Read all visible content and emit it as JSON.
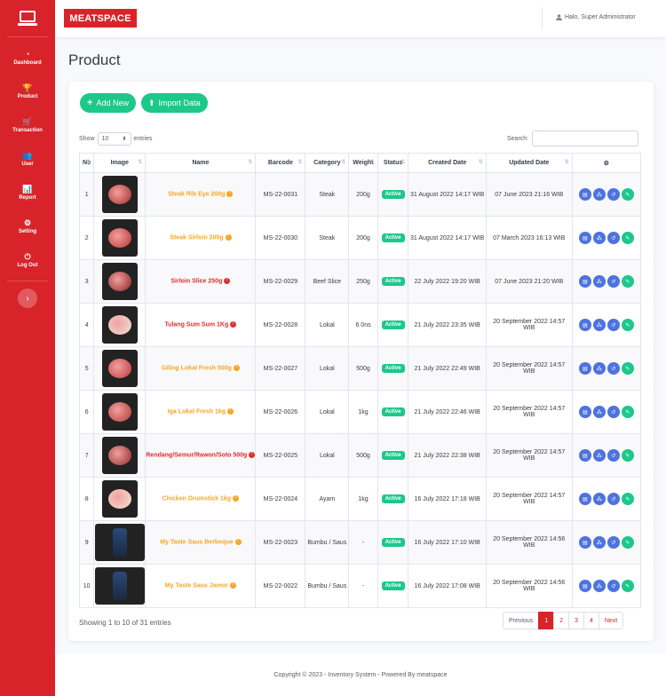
{
  "sidebar": {
    "items": [
      {
        "label": "Dashboard",
        "icon": "gauge-icon",
        "glyph": "◔"
      },
      {
        "label": "Product",
        "icon": "trophy-icon",
        "glyph": "🏆"
      },
      {
        "label": "Transaction",
        "icon": "cart-icon",
        "glyph": "🛒"
      },
      {
        "label": "User",
        "icon": "users-icon",
        "glyph": "👥"
      },
      {
        "label": "Report",
        "icon": "chart-icon",
        "glyph": "📊"
      },
      {
        "label": "Setting",
        "icon": "gears-icon",
        "glyph": "⚙"
      },
      {
        "label": "Log Out",
        "icon": "power-icon",
        "glyph": "⏻"
      }
    ],
    "toggle_glyph": "›"
  },
  "topbar": {
    "logo": "MEATSPACE",
    "user": "Halo, Super Administrator"
  },
  "page": {
    "title": "Product"
  },
  "toolbar": {
    "add_label": "Add New",
    "import_label": "Import Data"
  },
  "table_controls": {
    "show_label": "Show",
    "entries_value": "10",
    "entries_label": "entries",
    "search_label": "Search:",
    "search_value": ""
  },
  "columns": [
    "No",
    "Image",
    "Name",
    "Barcode",
    "Category",
    "Weight",
    "Status",
    "Created Date",
    "Updated Date",
    "⚙"
  ],
  "rows": [
    {
      "no": "1",
      "name": "Steak Rib Eye 200g",
      "stock": "warning",
      "barcode": "MS-22-0031",
      "category": "Steak",
      "weight": "200g",
      "status": "Active",
      "created": "31 August 2022 14:17 WIB",
      "updated": "07 June 2023 21:16 WIB"
    },
    {
      "no": "2",
      "name": "Steak Sirloin 200g",
      "stock": "warning",
      "barcode": "MS-22-0030",
      "category": "Steak",
      "weight": "200g",
      "status": "Active",
      "created": "31 August 2022 14:17 WIB",
      "updated": "07 March 2023 16:13 WIB"
    },
    {
      "no": "3",
      "name": "Sirloin Slice 250g",
      "stock": "danger",
      "barcode": "MS-22-0029",
      "category": "Beef Slice",
      "weight": "250g",
      "status": "Active",
      "created": "22 July 2022 19:20 WIB",
      "updated": "07 June 2023 21:20 WIB"
    },
    {
      "no": "4",
      "name": "Tulang Sum Sum 1Kg",
      "stock": "danger",
      "barcode": "MS-22-0028",
      "category": "Lokal",
      "weight": "6 0ns",
      "status": "Active",
      "created": "21 July 2022 23:35 WIB",
      "updated": "20 September 2022 14:57 WIB"
    },
    {
      "no": "5",
      "name": "Giling Lokal Fresh 500g",
      "stock": "warning",
      "barcode": "MS-22-0027",
      "category": "Lokal",
      "weight": "500g",
      "status": "Active",
      "created": "21 July 2022 22:49 WIB",
      "updated": "20 September 2022 14:57 WIB"
    },
    {
      "no": "6",
      "name": "Iga Lokal Fresh 1kg",
      "stock": "warning",
      "barcode": "MS-22-0026",
      "category": "Lokal",
      "weight": "1kg",
      "status": "Active",
      "created": "21 July 2022 22:46 WIB",
      "updated": "20 September 2022 14:57 WIB"
    },
    {
      "no": "7",
      "name": "Rendang/Semur/Rawon/Soto 500g",
      "stock": "danger",
      "barcode": "MS-22-0025",
      "category": "Lokal",
      "weight": "500g",
      "status": "Active",
      "created": "21 July 2022 22:38 WIB",
      "updated": "20 September 2022 14:57 WIB"
    },
    {
      "no": "8",
      "name": "Chicken Drumstick 1kg",
      "stock": "warning",
      "barcode": "MS-22-0024",
      "category": "Ayam",
      "weight": "1kg",
      "status": "Active",
      "created": "16 July 2022 17:18 WIB",
      "updated": "20 September 2022 14:57 WIB"
    },
    {
      "no": "9",
      "name": "My Taste Saus Berbeque",
      "stock": "warning",
      "barcode": "MS-22-0023",
      "category": "Bumbu / Saus",
      "weight": "-",
      "status": "Active",
      "created": "16 July 2022 17:10 WIB",
      "updated": "20 September 2022 14:56 WIB"
    },
    {
      "no": "10",
      "name": "My Taste Saus Jamur",
      "stock": "warning",
      "barcode": "MS-22-0022",
      "category": "Bumbu / Saus",
      "weight": "-",
      "status": "Active",
      "created": "16 July 2022 17:08 WIB",
      "updated": "20 September 2022 14:56 WIB"
    }
  ],
  "pagination": {
    "showing": "Showing 1 to 10 of 31 entries",
    "previous": "Previous",
    "pages": [
      "1",
      "2",
      "3",
      "4"
    ],
    "next": "Next"
  },
  "footer": {
    "text": "Copyright © 2023 - Inventory System - Powered By meatspace"
  },
  "colors": {
    "brand": "#d9232a",
    "success": "#1cc88a",
    "primary": "#4e73df",
    "warning": "#f6a623",
    "danger": "#e02d2d"
  }
}
